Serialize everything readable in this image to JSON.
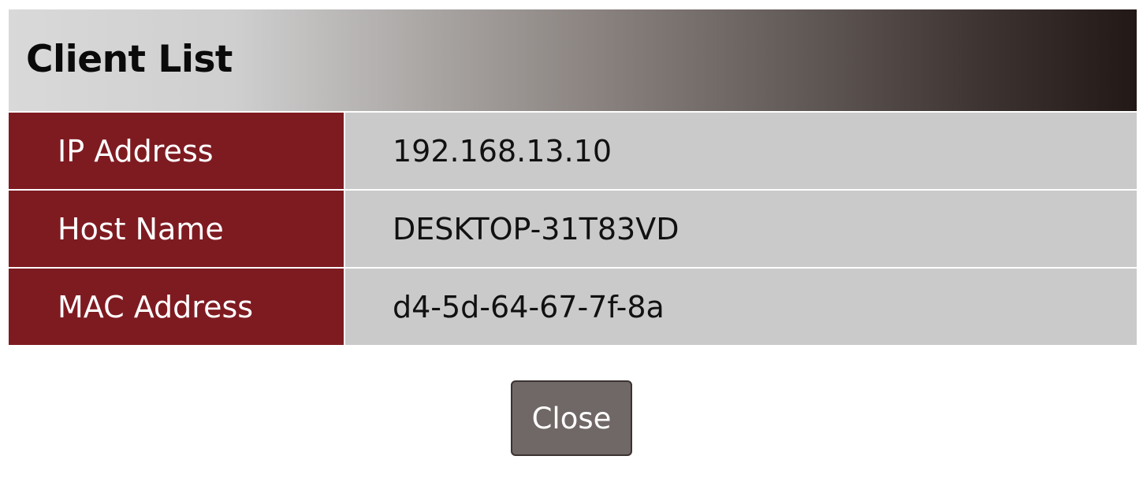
{
  "dialog": {
    "title": "Client List",
    "rows": [
      {
        "label": "IP Address",
        "value": "192.168.13.10"
      },
      {
        "label": "Host Name",
        "value": "DESKTOP-31T83VD"
      },
      {
        "label": "MAC Address",
        "value": "d4-5d-64-67-7f-8a"
      }
    ],
    "close_label": "Close"
  },
  "colors": {
    "label_background": "#7e1b21",
    "value_background": "#c9cac9",
    "button_background": "#706866",
    "title_gradient_start": "#d9d9d9",
    "title_gradient_end": "#221816"
  }
}
